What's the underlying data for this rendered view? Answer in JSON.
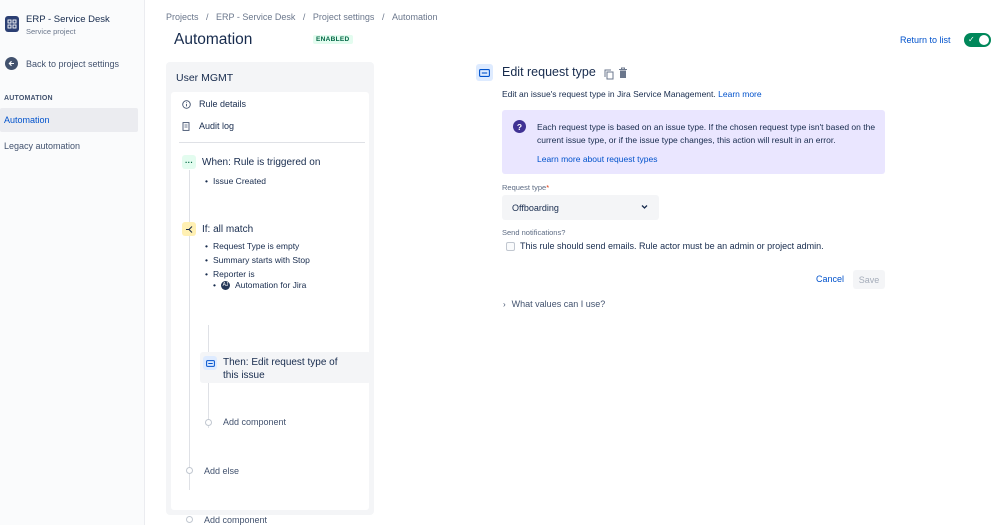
{
  "sidebar": {
    "project_name": "ERP - Service Desk",
    "project_type": "Service project",
    "back_label": "Back to project settings",
    "section_heading": "AUTOMATION",
    "items": [
      {
        "label": "Automation",
        "active": true
      },
      {
        "label": "Legacy automation",
        "active": false
      }
    ]
  },
  "header": {
    "breadcrumb": [
      "Projects",
      "ERP - Service Desk",
      "Project settings",
      "Automation"
    ],
    "title": "Automation",
    "status_badge": "ENABLED",
    "return_label": "Return to list",
    "toggle_on": true
  },
  "rule": {
    "name": "User MGMT",
    "rule_details_label": "Rule details",
    "audit_log_label": "Audit log",
    "trigger": {
      "label": "When: Rule is triggered on",
      "items": [
        "Issue Created"
      ]
    },
    "condition": {
      "label": "If: all match",
      "items": [
        "Request Type is empty",
        "Summary starts with Stop",
        "Reporter is"
      ],
      "reporter_value": "Automation for Jira",
      "avatar_initials": "AJ"
    },
    "action": {
      "line1": "Then: Edit request type of",
      "line2": "this issue"
    },
    "add_component_inner": "Add component",
    "add_else": "Add else",
    "add_component_outer": "Add component"
  },
  "details": {
    "title": "Edit request type",
    "description": "Edit an issue's request type in Jira Service Management.",
    "learn_more": "Learn more",
    "info_text": "Each request type is based on an issue type. If the chosen request type isn't based on the current issue type, or if the issue type changes, this action will result in an error.",
    "info_link": "Learn more about request types",
    "request_type_label": "Request type",
    "required_mark": "*",
    "request_type_value": "Offboarding",
    "send_notifications_label": "Send notifications?",
    "checkbox_label": "This rule should send emails. Rule actor must be an admin or project admin.",
    "checkbox_checked": false,
    "cancel_label": "Cancel",
    "save_label": "Save",
    "what_values_label": "What values can I use?"
  },
  "colors": {
    "accent": "#0052cc",
    "enabled_bg": "#e3fcef",
    "toggle": "#00875a",
    "info_bg": "#eae6ff"
  }
}
